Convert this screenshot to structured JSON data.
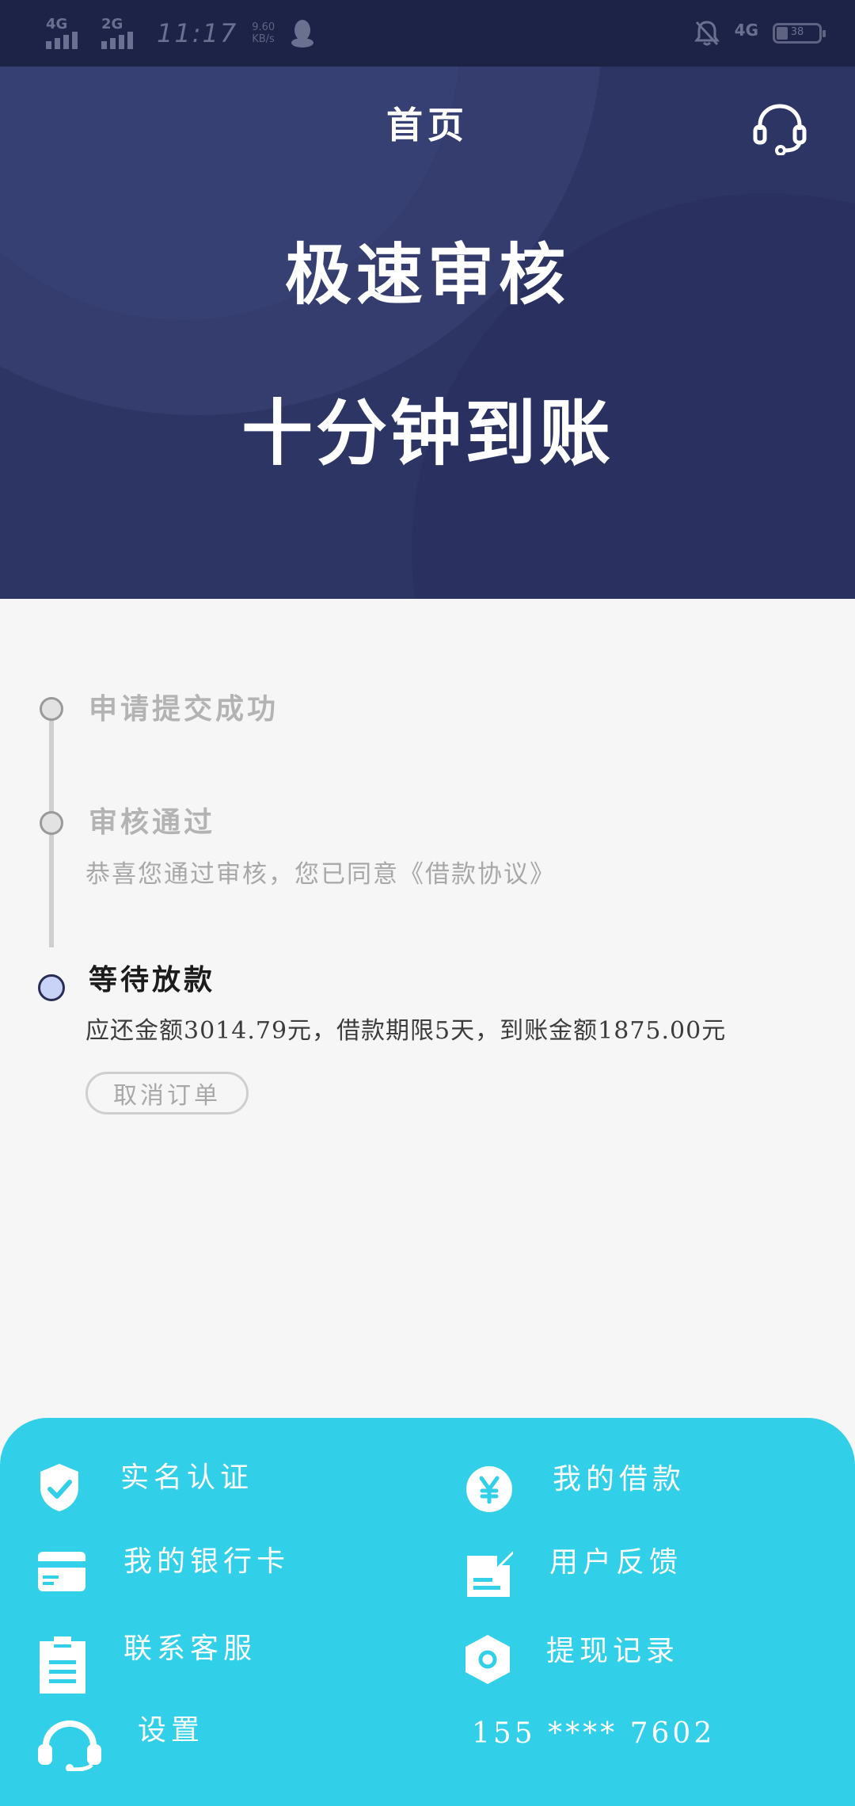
{
  "status_bar": {
    "network_1": "4G",
    "network_2": "2G",
    "time": "11:17",
    "speed_value": "9.60",
    "speed_unit": "KB/s",
    "network_right": "4G",
    "battery_level": "38"
  },
  "header": {
    "title": "首页",
    "slogan_line1": "极速审核",
    "slogan_line2": "十分钟到账"
  },
  "timeline": {
    "steps": [
      {
        "title": "申请提交成功",
        "desc": ""
      },
      {
        "title": "审核通过",
        "desc": "恭喜您通过审核，您已同意《借款协议》"
      },
      {
        "title": "等待放款",
        "desc": "应还金额3014.79元，借款期限5天，到账金额1875.00元"
      }
    ],
    "cancel_label": "取消订单"
  },
  "menu": {
    "items": [
      {
        "label": "实名认证",
        "icon": "shield-check-icon"
      },
      {
        "label": "我的借款",
        "icon": "yen-circle-icon"
      },
      {
        "label": "我的银行卡",
        "icon": "bank-card-icon"
      },
      {
        "label": "用户反馈",
        "icon": "feedback-edit-icon"
      },
      {
        "label": "联系客服",
        "icon": "clipboard-icon"
      },
      {
        "label": "提现记录",
        "icon": "hexagon-record-icon"
      },
      {
        "label": "设置",
        "icon": "headset-icon"
      }
    ],
    "phone": "155 **** 7602"
  },
  "colors": {
    "banner": "#2d3565",
    "menu_bg": "#31cfe8",
    "active_dot": "#c9d2f7"
  }
}
